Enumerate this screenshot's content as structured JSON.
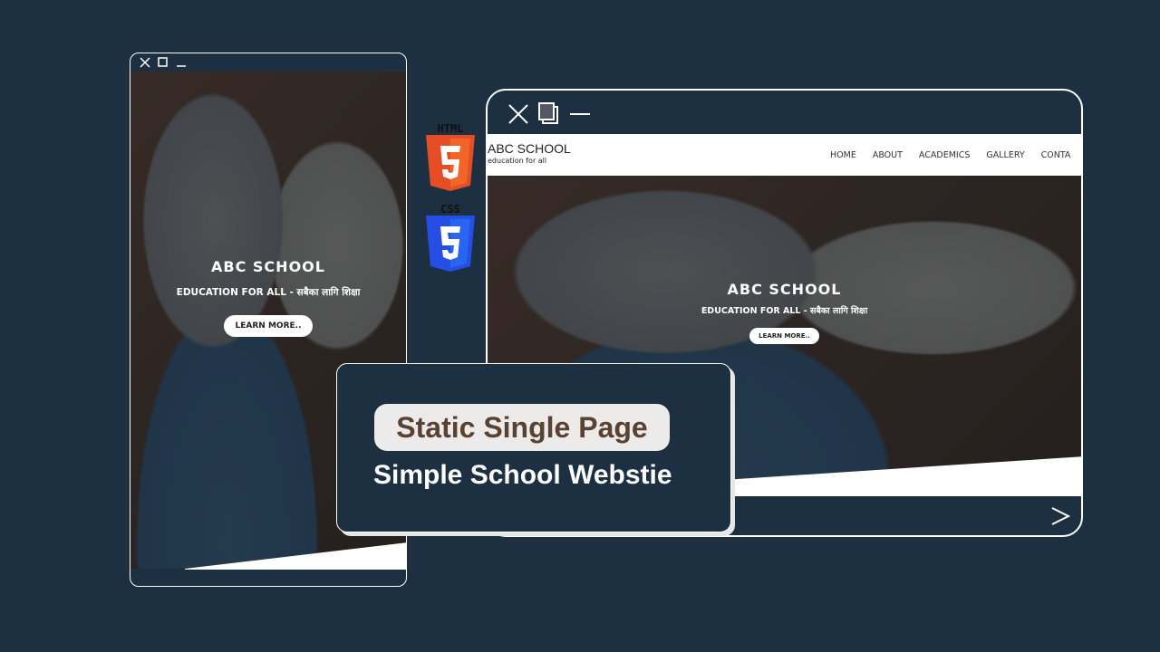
{
  "site": {
    "name": "ABC SCHOOL",
    "tagline": "education for all",
    "hero_sub": "EDUCATION FOR ALL - सबैका लागि शिक्षा",
    "cta": "LEARN MORE.."
  },
  "nav": [
    "HOME",
    "ABOUT",
    "ACADEMICS",
    "GALLERY",
    "CONTA"
  ],
  "badges": {
    "html": "HTML",
    "css": "CSS"
  },
  "card": {
    "title": "Static Single Page",
    "subtitle": "Simple School Webstie"
  },
  "colors": {
    "bg": "#1c3042",
    "pill_text": "#5a4232",
    "html": "#e44d26",
    "css": "#264de4"
  }
}
